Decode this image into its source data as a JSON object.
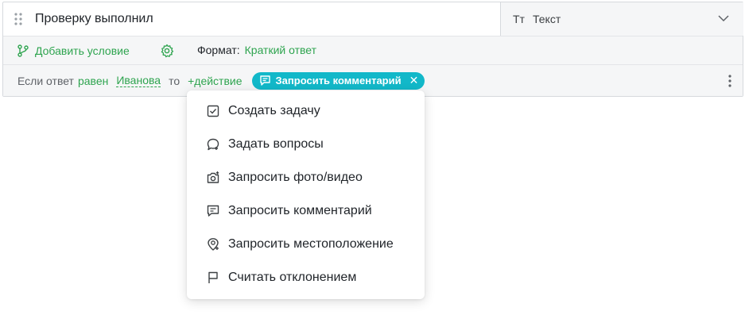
{
  "question": {
    "title": "Проверку выполнил",
    "type_icon": "Tт",
    "type_label": "Текст"
  },
  "toolbar": {
    "add_condition_label": "Добавить условие",
    "format_label": "Формат:",
    "format_value": "Краткий ответ"
  },
  "rule": {
    "prefix": "Если ответ",
    "operator": "равен",
    "value": "Иванова",
    "to": "то",
    "add_action": "+действие",
    "chip_label": "Запросить комментарий"
  },
  "menu": {
    "items": [
      {
        "label": "Создать задачу",
        "icon": "checkbox-icon"
      },
      {
        "label": "Задать вопросы",
        "icon": "question-bubble-icon"
      },
      {
        "label": "Запросить фото/видео",
        "icon": "camera-plus-icon"
      },
      {
        "label": "Запросить комментарий",
        "icon": "comment-plus-icon"
      },
      {
        "label": "Запросить местоположение",
        "icon": "location-plus-icon"
      },
      {
        "label": "Считать отклонением",
        "icon": "flag-icon"
      }
    ]
  },
  "colors": {
    "accent_green": "#2ea44f",
    "chip_teal": "#12b8c9",
    "border": "#d6d9dd",
    "panel_bg": "#f5f6f7"
  }
}
